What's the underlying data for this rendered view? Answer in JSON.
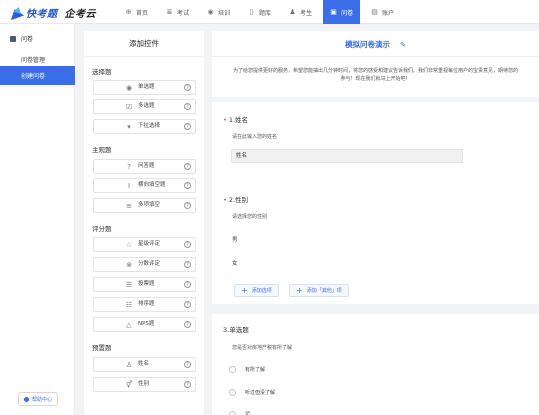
{
  "brand": {
    "name1": "快考题",
    "name2": "企考云"
  },
  "nav": [
    {
      "label": "首页",
      "icon": "home-icon",
      "glyph": "⊕"
    },
    {
      "label": "考试",
      "icon": "exam-icon",
      "glyph": "≣"
    },
    {
      "label": "培训",
      "icon": "training-icon",
      "glyph": "◉"
    },
    {
      "label": "题库",
      "icon": "question-bank-icon",
      "glyph": "▯"
    },
    {
      "label": "考生",
      "icon": "examinee-icon",
      "glyph": "♟"
    },
    {
      "label": "问卷",
      "icon": "survey-icon",
      "glyph": "▣",
      "active": true
    },
    {
      "label": "账户",
      "icon": "account-icon",
      "glyph": "▤"
    }
  ],
  "sidebar": {
    "header": "问卷",
    "items": [
      "问卷管理",
      "创建问卷"
    ],
    "help": "帮助中心"
  },
  "controls": {
    "title": "添加控件",
    "groups": [
      {
        "title": "选择题",
        "items": [
          {
            "label": "单选题",
            "icon": "radio-icon",
            "glyph": "◉"
          },
          {
            "label": "多选题",
            "icon": "checkbox-icon",
            "glyph": "☑"
          },
          {
            "label": "下拉选择",
            "icon": "dropdown-icon",
            "glyph": "▾"
          }
        ]
      },
      {
        "title": "主观题",
        "items": [
          {
            "label": "问答题",
            "icon": "qa-icon",
            "glyph": "?"
          },
          {
            "label": "横向填空题",
            "icon": "horizontal-fill-icon",
            "glyph": "I"
          },
          {
            "label": "多项填空",
            "icon": "multi-fill-icon",
            "glyph": "≡"
          }
        ]
      },
      {
        "title": "评分题",
        "items": [
          {
            "label": "星级评定",
            "icon": "star-icon",
            "glyph": "☆"
          },
          {
            "label": "分数评定",
            "icon": "score-icon",
            "glyph": "⊗"
          },
          {
            "label": "投票题",
            "icon": "vote-icon",
            "glyph": "☰"
          },
          {
            "label": "排序题",
            "icon": "sort-icon",
            "glyph": "☷"
          },
          {
            "label": "NPS题",
            "icon": "nps-icon",
            "glyph": "△"
          }
        ]
      },
      {
        "title": "预置题",
        "items": [
          {
            "label": "姓名",
            "icon": "person-icon",
            "glyph": "♙"
          },
          {
            "label": "性别",
            "icon": "gender-icon",
            "glyph": "⚥"
          }
        ]
      }
    ]
  },
  "form": {
    "title": "模拟问卷演示",
    "intro": "为了给您提供更好的服务，希望您能抽出几分钟时间，将您的感受和建议告诉我们。我们非常重视每位用户的宝贵意见，期待您的参与！现在我们就马上开始吧！",
    "q1": {
      "title": "1.姓名",
      "desc": "请在此输入您的姓名",
      "value": "姓名"
    },
    "q2": {
      "title": "2.性别",
      "desc": "请选择您的性别",
      "options": [
        "男",
        "女"
      ],
      "add_option": "添加选项",
      "add_other": "添加「其他」项"
    },
    "q3": {
      "title": "3.单选题",
      "desc": "您是否对房地产税有所了解",
      "options": [
        "有所了解",
        "听过但没了解",
        "记"
      ]
    }
  }
}
